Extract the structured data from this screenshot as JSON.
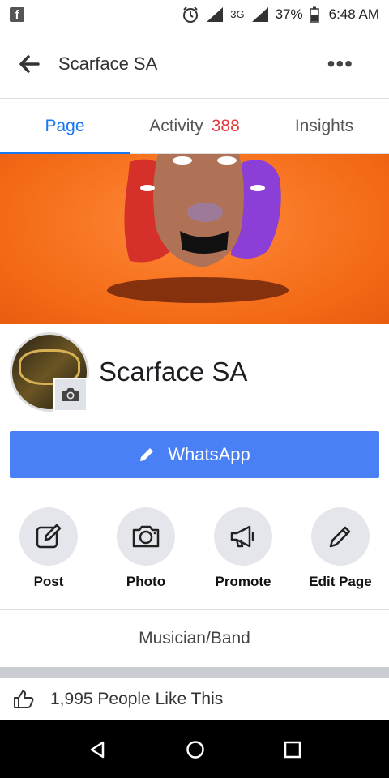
{
  "status": {
    "network": "3G",
    "battery": "37%",
    "time": "6:48 AM"
  },
  "topbar": {
    "title": "Scarface SA"
  },
  "tabs": [
    {
      "label": "Page"
    },
    {
      "label": "Activity",
      "count": "388"
    },
    {
      "label": "Insights"
    }
  ],
  "profile": {
    "name": "Scarface SA"
  },
  "whatsapp": {
    "label": "WhatsApp"
  },
  "actions": [
    {
      "label": "Post",
      "icon": "compose-icon"
    },
    {
      "label": "Photo",
      "icon": "camera-icon"
    },
    {
      "label": "Promote",
      "icon": "megaphone-icon"
    },
    {
      "label": "Edit Page",
      "icon": "pencil-icon"
    }
  ],
  "category": "Musician/Band",
  "likes": "1,995 People Like This",
  "colors": {
    "accent": "#1877f2",
    "button": "#4a80f5",
    "badge": "#e4393c",
    "cover": "#f36a16"
  }
}
